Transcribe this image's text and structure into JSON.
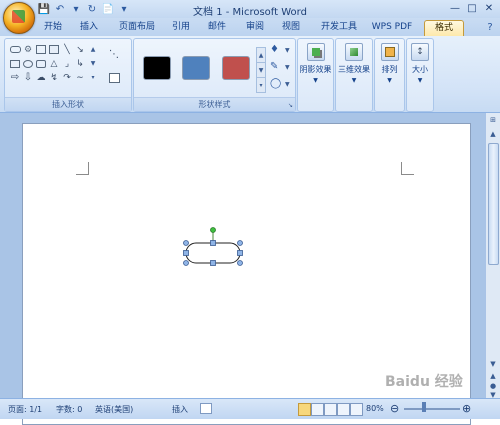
{
  "window": {
    "title": "文档 1 - Microsoft Word"
  },
  "tabs": [
    {
      "label": "开始",
      "active": false
    },
    {
      "label": "插入",
      "active": false
    },
    {
      "label": "页面布局",
      "active": false
    },
    {
      "label": "引用",
      "active": false
    },
    {
      "label": "邮件",
      "active": false
    },
    {
      "label": "审阅",
      "active": false
    },
    {
      "label": "视图",
      "active": false
    },
    {
      "label": "开发工具",
      "active": false
    },
    {
      "label": "WPS PDF",
      "active": false
    },
    {
      "label": "格式",
      "active": true
    }
  ],
  "ribbon": {
    "insert_shapes_label": "插入形状",
    "shape_styles_label": "形状样式",
    "shadow_effects": "阴影效果",
    "three_d_effects": "三维效果",
    "arrange": "排列",
    "size": "大小",
    "style_colors": [
      "#000000",
      "#4f81bd",
      "#c0504d"
    ]
  },
  "statusbar": {
    "page": "页面: 1/1",
    "words": "字数: 0",
    "language": "英语(美国)",
    "mode": "插入",
    "zoom": "80%"
  },
  "watermark": "Baidu 经验"
}
